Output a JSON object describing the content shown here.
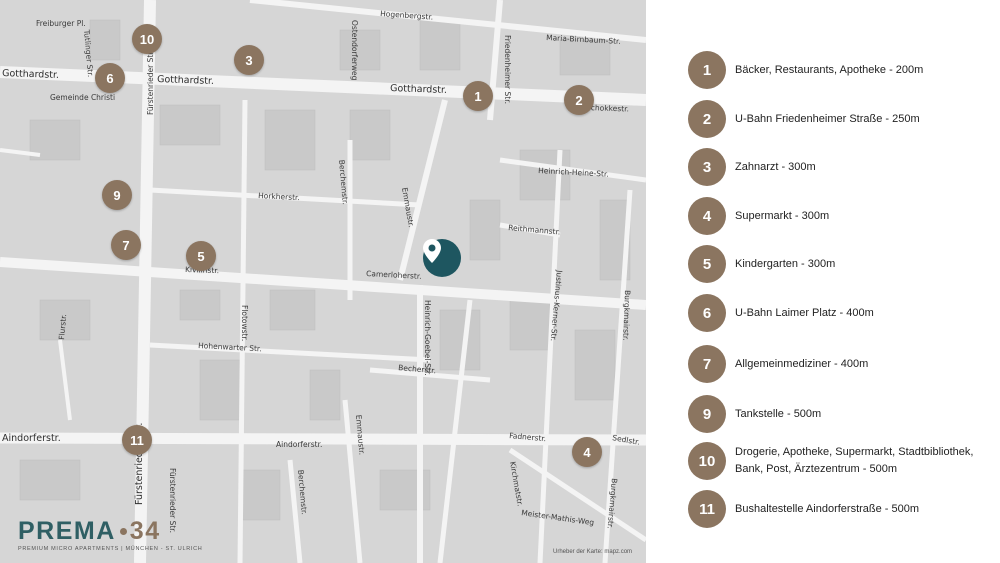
{
  "map": {
    "attribution": "Urheber der Karte: mapz.com",
    "streets": [
      "Freiburger Pl.",
      "Tutlinger Str.",
      "Hogenbergstr.",
      "Maria-Birnbaum-Str.",
      "Gotthardstr.",
      "Gotthardstr.",
      "Gotthardstr.",
      "Ostendorferweg",
      "Friedenheimer Str.",
      "Gemeinde Christi",
      "Fürstenrieder Str.",
      "Schokkestr.",
      "Heinrich-Heine-Str.",
      "Horkherstr.",
      "Berchemstr.",
      "Emmaustr.",
      "Reithmannstr.",
      "Camerloherstr.",
      "Kivilinstr.",
      "Flotowstr.",
      "Heinrich-Goebel-Str.",
      "Justinus-Kerner-Str.",
      "Burgkmairstr.",
      "Hohenwarter Str.",
      "Flurstr.",
      "Becherstr.",
      "Aindorferstr.",
      "Aindorferstr.",
      "Emmaustr.",
      "Fadnerstr.",
      "Sedlstr.",
      "Kirchmatstr.",
      "Burgkmairstr.",
      "Meister-Mathis-Weg",
      "Fürstenrieder Str.",
      "Fürstenrieder Str.",
      "Berchemstr."
    ],
    "markers": [
      "1",
      "2",
      "3",
      "4",
      "5",
      "6",
      "7",
      "9",
      "10",
      "11"
    ]
  },
  "brand": {
    "name_part1": "PREMA",
    "name_part2": "34",
    "tagline": "PREMIUM MICRO APARTMENTS | MÜNCHEN - ST. ULRICH"
  },
  "legend": [
    {
      "num": "1",
      "label": "Bäcker, Restaurants, Apotheke - 200m"
    },
    {
      "num": "2",
      "label": "U-Bahn Friedenheimer Straße - 250m"
    },
    {
      "num": "3",
      "label": "Zahnarzt - 300m"
    },
    {
      "num": "4",
      "label": "Supermarkt - 300m"
    },
    {
      "num": "5",
      "label": "Kindergarten - 300m"
    },
    {
      "num": "6",
      "label": "U-Bahn Laimer Platz - 400m"
    },
    {
      "num": "7",
      "label": "Allgemeinmediziner - 400m"
    },
    {
      "num": "9",
      "label": "Tankstelle - 500m"
    },
    {
      "num": "10",
      "label": "Drogerie, Apotheke, Supermarkt, Stadtbibliothek, Bank, Post, Ärztezentrum - 500m"
    },
    {
      "num": "11",
      "label": "Bushaltestelle Aindorferstraße - 500m"
    }
  ],
  "colors": {
    "marker": "#8b7560",
    "pin": "#1e5660",
    "brand_primary": "#2f5f64",
    "map_block": "#d6d6d6",
    "map_road": "#f4f4f4"
  },
  "icons": {
    "pin": "map-pin-icon"
  }
}
